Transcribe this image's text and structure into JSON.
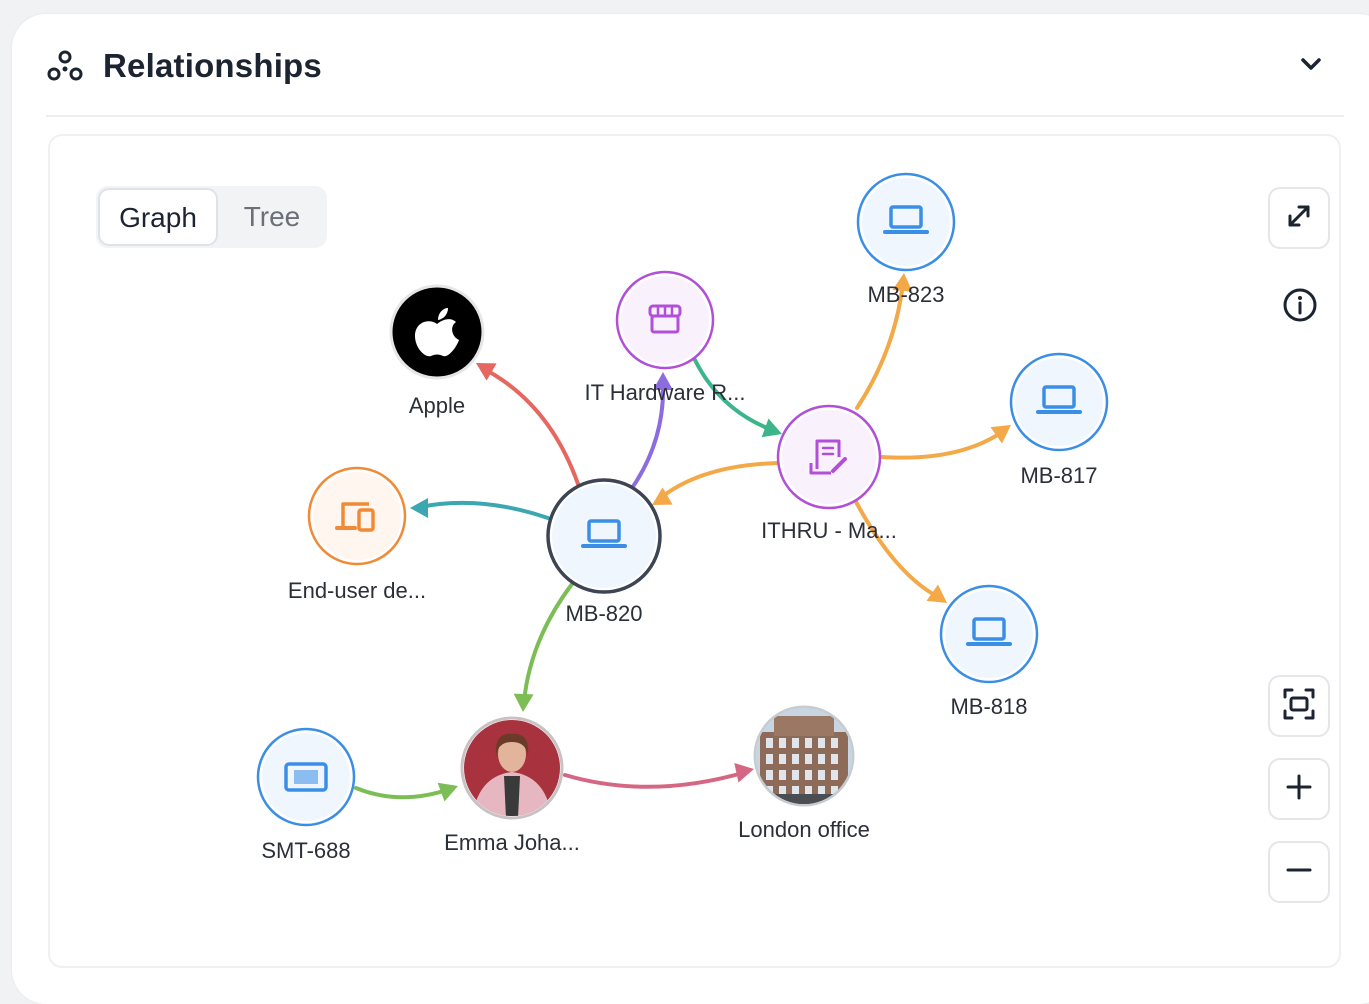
{
  "header": {
    "title": "Relationships",
    "icon": "relationships-icon",
    "collapse_icon": "chevron-down-icon"
  },
  "view_toggle": {
    "options": [
      "Graph",
      "Tree"
    ],
    "selected": "Graph"
  },
  "controls": {
    "expand_icon": "expand-icon",
    "info_icon": "info-icon",
    "fit_icon": "fit-to-screen-icon",
    "zoom_in_icon": "plus-icon",
    "zoom_out_icon": "minus-icon"
  },
  "graph": {
    "nodes": [
      {
        "id": "mb820",
        "label": "MB-820",
        "icon": "laptop-icon",
        "color": "#3a8ee6",
        "ring": "#3d4453"
      },
      {
        "id": "apple",
        "label": "Apple",
        "icon": "apple-logo",
        "color": "#000000"
      },
      {
        "id": "ithw",
        "label": "IT Hardware R...",
        "icon": "store-icon",
        "color": "#b24fd8"
      },
      {
        "id": "ithru",
        "label": "ITHRU - Ma...",
        "icon": "contract-icon",
        "color": "#b24fd8"
      },
      {
        "id": "enduser",
        "label": "End-user de...",
        "icon": "devices-icon",
        "color": "#f08a36"
      },
      {
        "id": "mb823",
        "label": "MB-823",
        "icon": "laptop-icon",
        "color": "#3a8ee6"
      },
      {
        "id": "mb817",
        "label": "MB-817",
        "icon": "laptop-icon",
        "color": "#3a8ee6"
      },
      {
        "id": "mb818",
        "label": "MB-818",
        "icon": "laptop-icon",
        "color": "#3a8ee6"
      },
      {
        "id": "emma",
        "label": "Emma Joha...",
        "icon": "person-photo",
        "color": "#c9a0a8"
      },
      {
        "id": "smt688",
        "label": "SMT-688",
        "icon": "tablet-icon",
        "color": "#3a8ee6"
      },
      {
        "id": "london",
        "label": "London office",
        "icon": "building-photo",
        "color": "#a8b6c2"
      }
    ],
    "edges": [
      {
        "from": "mb820",
        "to": "apple",
        "color": "#e5675f"
      },
      {
        "from": "mb820",
        "to": "ithw",
        "color": "#8c6de0"
      },
      {
        "from": "ithw",
        "to": "ithru",
        "color": "#3db48a"
      },
      {
        "from": "ithru",
        "to": "mb820",
        "color": "#f3a948"
      },
      {
        "from": "mb820",
        "to": "enduser",
        "color": "#3aa7b1"
      },
      {
        "from": "ithru",
        "to": "mb823",
        "color": "#f3a948"
      },
      {
        "from": "ithru",
        "to": "mb817",
        "color": "#f3a948"
      },
      {
        "from": "ithru",
        "to": "mb818",
        "color": "#f3a948"
      },
      {
        "from": "mb820",
        "to": "emma",
        "color": "#7dbd55"
      },
      {
        "from": "smt688",
        "to": "emma",
        "color": "#7dbd55"
      },
      {
        "from": "emma",
        "to": "london",
        "color": "#d66784"
      }
    ]
  }
}
